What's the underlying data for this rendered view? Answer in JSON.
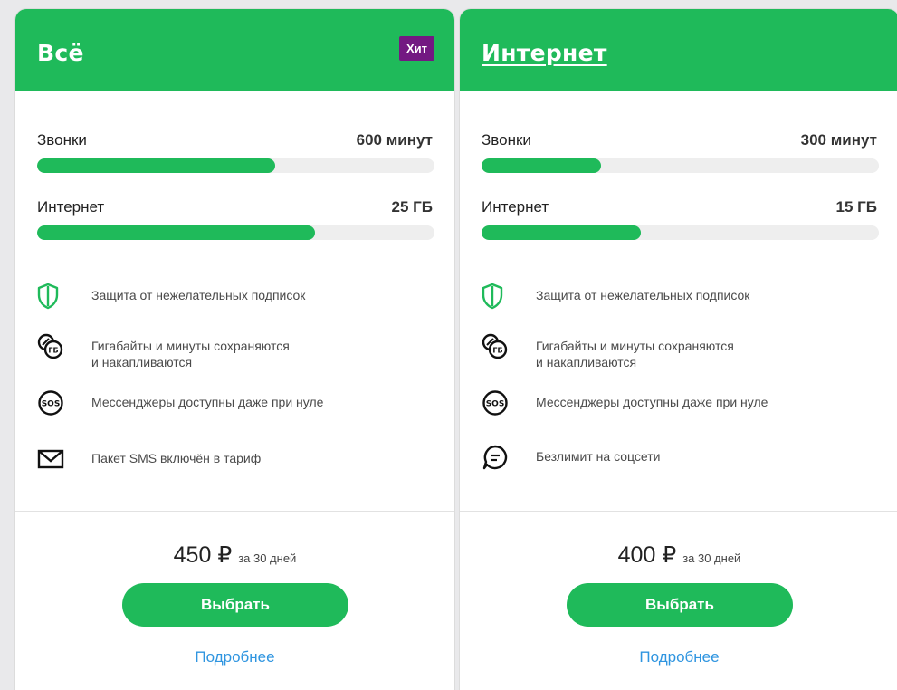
{
  "colors": {
    "brand_green": "#1fba5a",
    "badge_purple": "#731982",
    "link_blue": "#2f95e0"
  },
  "cards": [
    {
      "title": "Всё",
      "badge": "Хит",
      "calls": {
        "label": "Звонки",
        "value": "600 минут",
        "fill": 0.6
      },
      "internet": {
        "label": "Интернет",
        "value": "25 ГБ",
        "fill": 0.7
      },
      "features": [
        {
          "icon": "shield-icon",
          "text_lines": [
            "Защита от нежелательных подписок"
          ]
        },
        {
          "icon": "rollover-gb-icon",
          "text_lines": [
            "Гигабайты и минуты сохраняются",
            "и накапливаются"
          ]
        },
        {
          "icon": "sos-icon",
          "text_lines": [
            "Мессенджеры доступны даже при нуле"
          ]
        },
        {
          "icon": "envelope-icon",
          "text_lines": [
            "Пакет SMS включён в тариф"
          ]
        }
      ],
      "price": "450 ₽",
      "price_period": "за 30 дней",
      "select_label": "Выбрать",
      "more_label": "Подробнее"
    },
    {
      "title": "Интернет",
      "badge": "",
      "calls": {
        "label": "Звонки",
        "value": "300 минут",
        "fill": 0.3
      },
      "internet": {
        "label": "Интернет",
        "value": "15 ГБ",
        "fill": 0.4
      },
      "features": [
        {
          "icon": "shield-icon",
          "text_lines": [
            "Защита от нежелательных подписок"
          ]
        },
        {
          "icon": "rollover-gb-icon",
          "text_lines": [
            "Гигабайты и минуты сохраняются",
            "и накапливаются"
          ]
        },
        {
          "icon": "sos-icon",
          "text_lines": [
            "Мессенджеры доступны даже при нуле"
          ]
        },
        {
          "icon": "chat-bubble-icon",
          "text_lines": [
            "Безлимит на соцсети"
          ]
        }
      ],
      "price": "400 ₽",
      "price_period": "за 30 дней",
      "select_label": "Выбрать",
      "more_label": "Подробнее"
    }
  ]
}
